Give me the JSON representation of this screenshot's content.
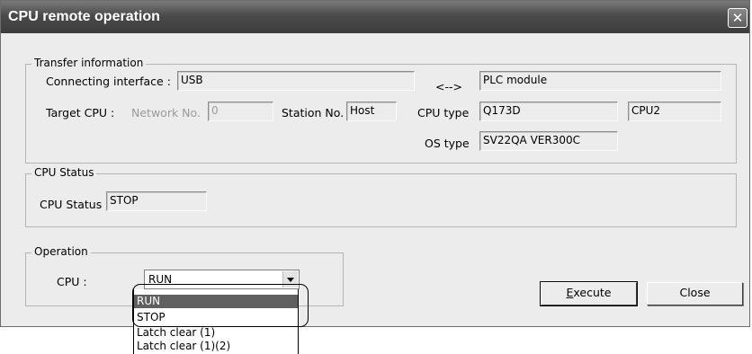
{
  "window": {
    "title": "CPU remote operation",
    "close_label": "✕"
  },
  "transfer": {
    "legend": "Transfer information",
    "connecting_interface_label": "Connecting interface :",
    "connecting_interface_value": "USB",
    "arrow": "<-->",
    "plc_module_value": "PLC module",
    "target_cpu_label": "Target CPU :",
    "network_no_label": "Network No.",
    "network_no_value": "0",
    "station_no_label": "Station No.",
    "station_no_value": "Host",
    "cpu_type_label": "CPU type",
    "cpu_type_value": "Q173D",
    "cpu_slot_value": "CPU2",
    "os_type_label": "OS type",
    "os_type_value": "SV22QA VER300C"
  },
  "cpu_status": {
    "legend": "CPU Status",
    "label": "CPU Status",
    "value": "STOP"
  },
  "operation": {
    "legend": "Operation",
    "cpu_label": "CPU :",
    "selected": "RUN",
    "options": [
      "RUN",
      "STOP",
      "Latch clear (1)",
      "Latch clear (1)(2)"
    ]
  },
  "buttons": {
    "execute_first": "E",
    "execute_rest": "xecute",
    "close": "Close"
  }
}
